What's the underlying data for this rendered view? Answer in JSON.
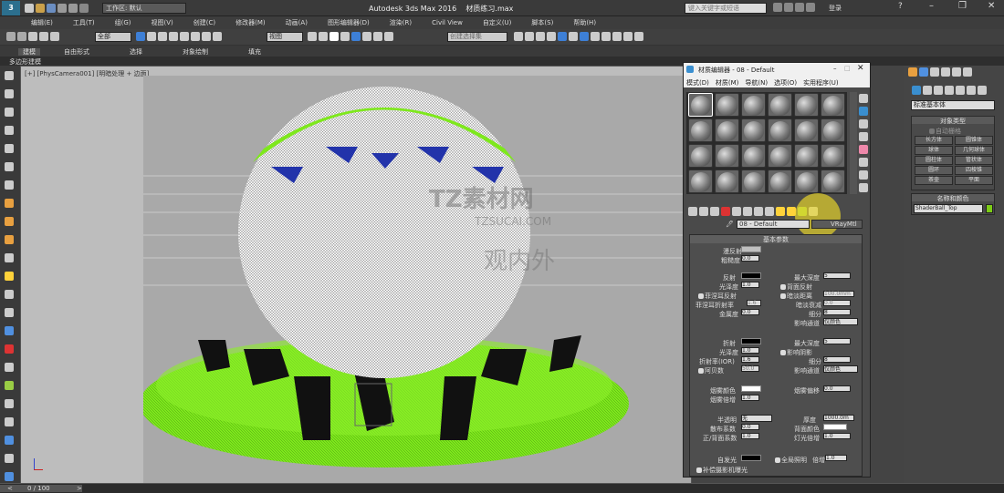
{
  "window": {
    "title": "Autodesk 3ds Max 2016",
    "filename": "材质练习.max",
    "workspace": "工作区: 默认",
    "search_placeholder": "键入关键字或短语",
    "user": "登录"
  },
  "menu": [
    "编辑(E)",
    "工具(T)",
    "组(G)",
    "视图(V)",
    "创建(C)",
    "修改器(M)",
    "动画(A)",
    "图形编辑器(D)",
    "渲染(R)",
    "Civil View",
    "自定义(U)",
    "脚本(S)",
    "帮助(H)"
  ],
  "toolbar": {
    "selection_set": "全部",
    "ref_coord": "视图",
    "named_sel": "创建选择集"
  },
  "ribbon": {
    "tabs": [
      "建模",
      "自由形式",
      "选择",
      "对象绘制",
      "填充"
    ],
    "sub_label": "多边形建模"
  },
  "viewport": {
    "label": "[+] [PhysCamera001] [明暗处理 + 边面]"
  },
  "status": {
    "frames": "0 / 100"
  },
  "material_editor": {
    "title": "材质编辑器 - 08 - Default",
    "menu": [
      "模式(D)",
      "材质(M)",
      "导航(N)",
      "选项(O)",
      "实用程序(U)"
    ],
    "material_name": "08 - Default",
    "material_type": "VRayMtl",
    "rollout_title": "基本参数",
    "diffuse": {
      "label1": "漫反射",
      "label2": "粗糙度",
      "rough": "0.0"
    },
    "reflect": {
      "label": "反射",
      "gloss_label": "光泽度",
      "gloss": "1.0",
      "fresnel": "菲涅耳反射",
      "fresnel_ior": "菲涅耳折射率",
      "fresnel_ior_val": "1.6",
      "metal_label": "金属度",
      "metal": "0.0",
      "max_depth_label": "最大深度",
      "max_depth": "5",
      "backside": "背面反射",
      "dim_dist": "暗淡距离",
      "dim_dist_val": "100.0mm",
      "dim_falloff": "暗淡衰减",
      "dim_falloff_val": "0.0",
      "subdiv_label": "细分",
      "subdiv": "8",
      "affect_label": "影响通道",
      "affect": "仅颜色"
    },
    "refract": {
      "label": "折射",
      "gloss_label": "光泽度",
      "gloss": "1.0",
      "ior_label": "折射率(IOR)",
      "ior": "1.6",
      "abbe_label": "阿贝数",
      "abbe": "50.0",
      "max_depth_label": "最大深度",
      "max_depth": "5",
      "affect_shadows": "影响阴影",
      "subdiv_label": "细分",
      "subdiv": "8",
      "affect_label": "影响通道",
      "affect": "仅颜色"
    },
    "fog": {
      "color_label": "烟雾颜色",
      "mult_label": "烟雾倍增",
      "mult": "1.0",
      "bias_label": "烟雾偏移",
      "bias": "0.0"
    },
    "translucency": {
      "label": "半透明",
      "type": "无",
      "thick_label": "厚度",
      "thick": "1000.0m",
      "scatter_label": "散布系数",
      "scatter": "0.0",
      "back_label": "背面颜色",
      "fb_label": "正/背面系数",
      "fb": "1.0",
      "light_label": "灯光倍增",
      "light": "1.0"
    },
    "self_illum": {
      "label": "自发光",
      "gi": "全局照明",
      "mult_label": "倍增",
      "mult": "1.0",
      "comp": "补偿摄影机曝光"
    }
  },
  "command_panel": {
    "dropdown": "标准基本体",
    "rollout_object": "对象类型",
    "autogrid": "自动栅格",
    "buttons": [
      "长方体",
      "圆锥体",
      "球体",
      "几何球体",
      "圆柱体",
      "管状体",
      "圆环",
      "四棱锥",
      "茶壶",
      "平面"
    ],
    "rollout_name": "名称和颜色",
    "object_name": "ShaderBall_Top",
    "color": "#7ccc16"
  },
  "watermark": {
    "brand": "TZ素材网",
    "url": "TZSUCAI.COM",
    "chinese": "观内外"
  }
}
